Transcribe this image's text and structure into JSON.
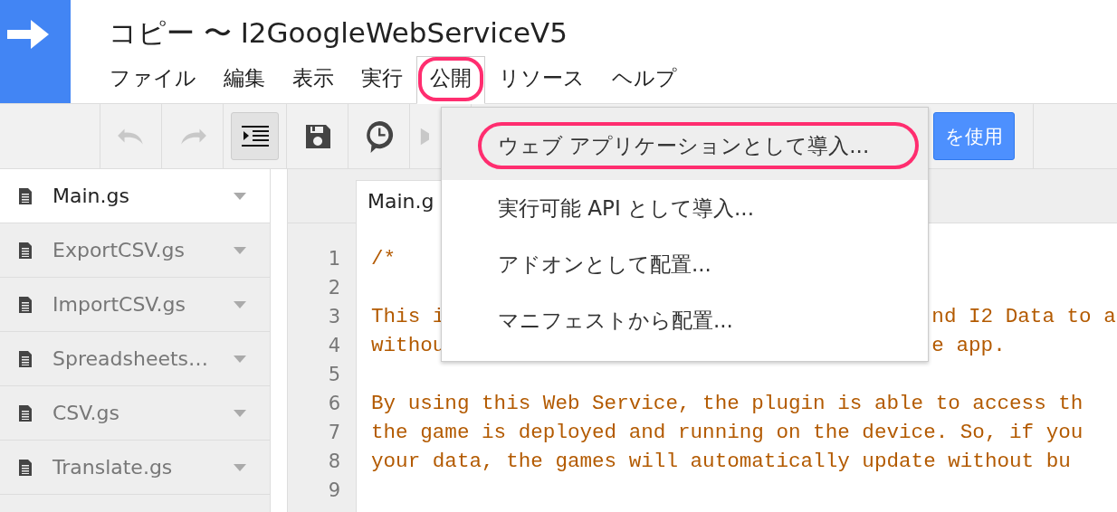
{
  "window": {
    "title": "コピー 〜 I2GoogleWebServiceV5"
  },
  "menu_bar": [
    {
      "label": "ファイル",
      "selected": false,
      "annotated": false
    },
    {
      "label": "編集",
      "selected": false,
      "annotated": false
    },
    {
      "label": "表示",
      "selected": false,
      "annotated": false
    },
    {
      "label": "実行",
      "selected": false,
      "annotated": false
    },
    {
      "label": "公開",
      "selected": true,
      "annotated": true
    },
    {
      "label": "リソース",
      "selected": false,
      "annotated": false
    },
    {
      "label": "ヘルプ",
      "selected": false,
      "annotated": false
    }
  ],
  "toolbar": {
    "items": [
      {
        "kind": "undo",
        "disabled": true,
        "pressed": false
      },
      {
        "kind": "redo",
        "disabled": true,
        "pressed": false
      },
      {
        "kind": "indent",
        "disabled": false,
        "pressed": true
      },
      {
        "kind": "save",
        "disabled": false,
        "pressed": false
      },
      {
        "kind": "history",
        "disabled": false,
        "pressed": false
      },
      {
        "kind": "run",
        "disabled": true,
        "pressed": false
      }
    ],
    "blue_button": "を使用"
  },
  "files": [
    {
      "name": "Main.gs",
      "selected": true
    },
    {
      "name": "ExportCSV.gs",
      "selected": false
    },
    {
      "name": "ImportCSV.gs",
      "selected": false
    },
    {
      "name": "Spreadsheets…",
      "selected": false
    },
    {
      "name": "CSV.gs",
      "selected": false
    },
    {
      "name": "Translate.gs",
      "selected": false
    }
  ],
  "editor": {
    "tab": "Main.g",
    "lines": [
      {
        "number": "1",
        "segments": [
          "/*"
        ]
      },
      {
        "number": "2"
      },
      {
        "number": "3",
        "segments": [
          "This i",
          "nd I2 Data to a"
        ]
      },
      {
        "number": "4",
        "segments": [
          "withou",
          "e app."
        ]
      },
      {
        "number": "5"
      },
      {
        "number": "6",
        "segments": [
          "By using this Web Service, the plugin is able to access th"
        ]
      },
      {
        "number": "7",
        "segments": [
          "the game is deployed and running on the device. So, if you"
        ]
      },
      {
        "number": "8",
        "segments": [
          "your data, the games will automatically update without bu"
        ]
      },
      {
        "number": "9"
      }
    ]
  },
  "dropdown": [
    {
      "label": "ウェブ アプリケーションとして導入...",
      "highlighted": true,
      "annotated": true
    },
    {
      "label": "実行可能 API として導入...",
      "highlighted": false,
      "annotated": false
    },
    {
      "label": "アドオンとして配置...",
      "highlighted": false,
      "annotated": false
    },
    {
      "label": "マニフェストから配置...",
      "highlighted": false,
      "annotated": false
    }
  ]
}
